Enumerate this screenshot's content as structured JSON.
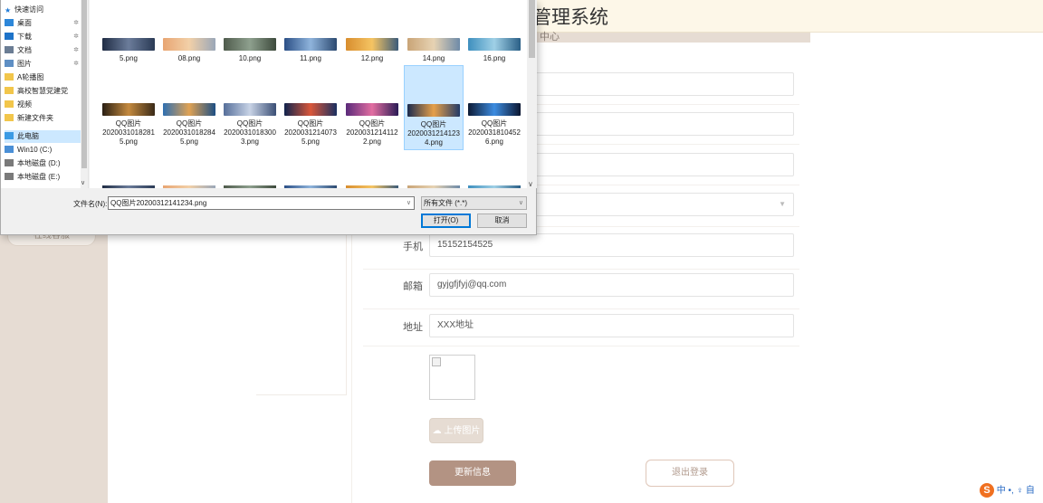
{
  "page": {
    "header_title": "管理系统",
    "sub_tab": "中心",
    "side_button": "在线客服",
    "form": [
      {
        "label": "",
        "value": ""
      },
      {
        "label": "",
        "value": ""
      },
      {
        "label": "",
        "value": ""
      },
      {
        "label": "",
        "value": "",
        "type": "select"
      },
      {
        "label": "手机",
        "value": "15152154525"
      },
      {
        "label": "邮箱",
        "value": "gyjgfjfyj@qq.com"
      },
      {
        "label": "地址",
        "value": "XXX地址"
      }
    ],
    "upload_label": "上传图片",
    "update_label": "更新信息",
    "logout_label": "退出登录",
    "ime_text": "中 •, ♀ 自"
  },
  "dialog": {
    "nav_items": [
      {
        "label": "快速访问",
        "icon": "star-icon",
        "color": "#1e7ad6"
      },
      {
        "label": "桌面",
        "icon": "desktop-icon",
        "color": "#2d87d9",
        "pinned": true
      },
      {
        "label": "下载",
        "icon": "download-icon",
        "color": "#1e73c9",
        "pinned": true
      },
      {
        "label": "文档",
        "icon": "document-icon",
        "color": "#6b7d94",
        "pinned": true
      },
      {
        "label": "图片",
        "icon": "pictures-icon",
        "color": "#5f8fc4",
        "pinned": true
      },
      {
        "label": "A轮播图",
        "icon": "folder-icon",
        "color": "#f2c64b"
      },
      {
        "label": "高校智慧党建党",
        "icon": "folder-icon",
        "color": "#f2c64b"
      },
      {
        "label": "视频",
        "icon": "folder-icon",
        "color": "#f2c64b"
      },
      {
        "label": "新建文件夹",
        "icon": "folder-icon",
        "color": "#f2c64b"
      },
      {
        "label": "此电脑",
        "icon": "computer-icon",
        "color": "#3b9be4",
        "selected": true
      },
      {
        "label": "Win10 (C:)",
        "icon": "drive-icon",
        "color": "#4a8fd6"
      },
      {
        "label": "本地磁盘 (D:)",
        "icon": "drive-icon",
        "color": "#7a7a7a"
      },
      {
        "label": "本地磁盘 (E:)",
        "icon": "drive-icon",
        "color": "#7a7a7a"
      }
    ],
    "files_row1": [
      "5.png",
      "08.png",
      "10.png",
      "11.png",
      "12.png",
      "14.png",
      "16.png"
    ],
    "files_row2": [
      {
        "name": "QQ图片\n2020031018281\n5.png"
      },
      {
        "name": "QQ图片\n2020031018284\n5.png"
      },
      {
        "name": "QQ图片\n2020031018300\n3.png"
      },
      {
        "name": "QQ图片\n2020031214073\n5.png"
      },
      {
        "name": "QQ图片\n2020031214112\n2.png"
      },
      {
        "name": "QQ图片\n2020031214123\n4.png",
        "selected": true
      },
      {
        "name": "QQ图片\n2020031810452\n6.png"
      }
    ],
    "filename_label": "文件名(N):",
    "filename_value": "QQ图片20200312141234.png",
    "filter_value": "所有文件 (*.*)",
    "open_label": "打开(O)",
    "cancel_label": "取消"
  },
  "colors": {
    "accent": "#b39383",
    "sidebar_bg": "#e6dcd3",
    "header_bg": "#fdf7e8",
    "dialog_selection": "#cce8ff",
    "dialog_focus_border": "#0078d7"
  }
}
